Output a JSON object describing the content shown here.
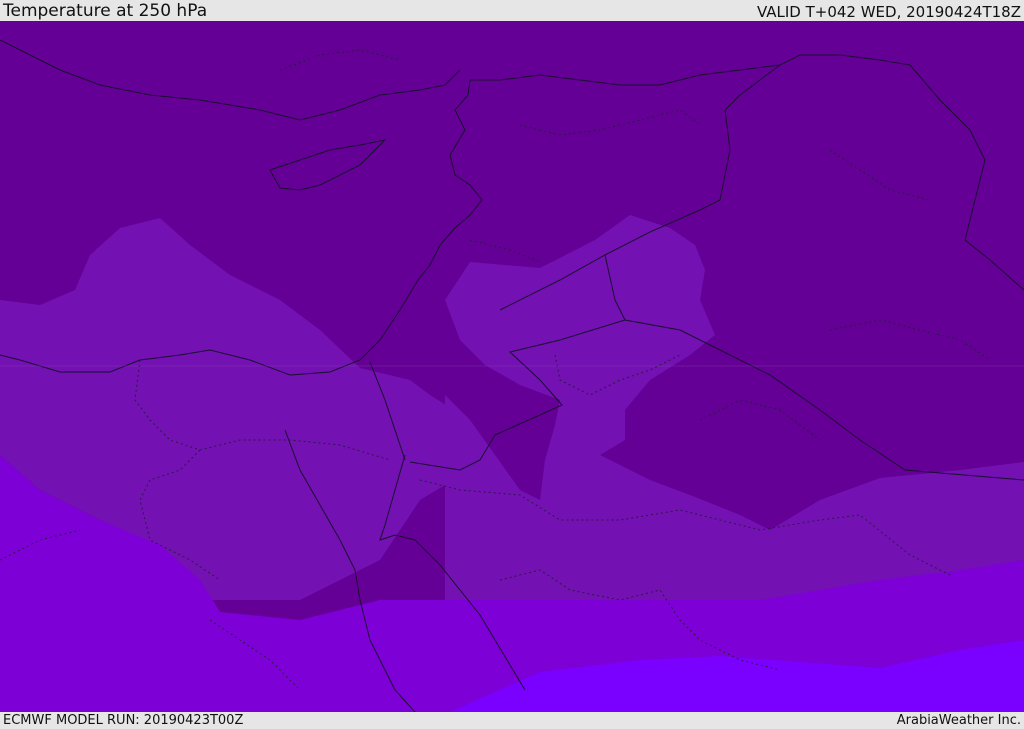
{
  "header": {
    "title": "Temperature at 250 hPa",
    "valid": "VALID T+042 WED, 20190424T18Z"
  },
  "footer": {
    "model_run": "ECMWF MODEL RUN: 20190423T00Z",
    "credit": "ArabiaWeather Inc."
  },
  "colors": {
    "band_coldest": "#650096",
    "band_cold": "#7311b2",
    "band_mid": "#7d00d6",
    "band_warm": "#7a00ff",
    "coastline": "#1a1030",
    "border_dotted": "#2a1a40"
  }
}
